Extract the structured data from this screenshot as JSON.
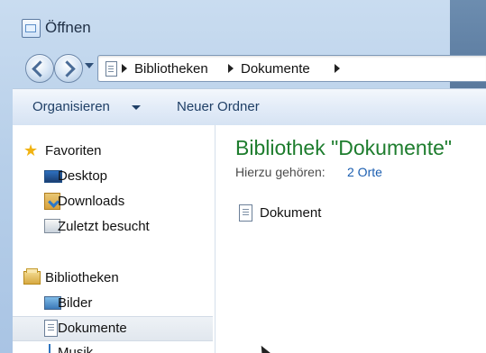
{
  "window": {
    "title": "Öffnen"
  },
  "address_bar": {
    "crumbs": [
      "Bibliotheken",
      "Dokumente"
    ]
  },
  "toolbar": {
    "organize_label": "Organisieren",
    "new_folder_label": "Neuer Ordner"
  },
  "nav_pane": {
    "favorites": {
      "label": "Favoriten",
      "items": [
        "Desktop",
        "Downloads",
        "Zuletzt besucht"
      ]
    },
    "libraries": {
      "label": "Bibliotheken",
      "items": [
        "Bilder",
        "Dokumente",
        "Musik"
      ],
      "selected": "Dokumente"
    }
  },
  "main": {
    "title": "Bibliothek \"Dokumente\"",
    "includes_label": "Hierzu gehören:",
    "includes_link": "2 Orte",
    "files": [
      {
        "name": "Dokument",
        "icon": "document-icon"
      }
    ]
  },
  "colors": {
    "title_green": "#1e7d2e",
    "link_blue": "#1b5eb0",
    "toolbar_text": "#1f3f66"
  }
}
